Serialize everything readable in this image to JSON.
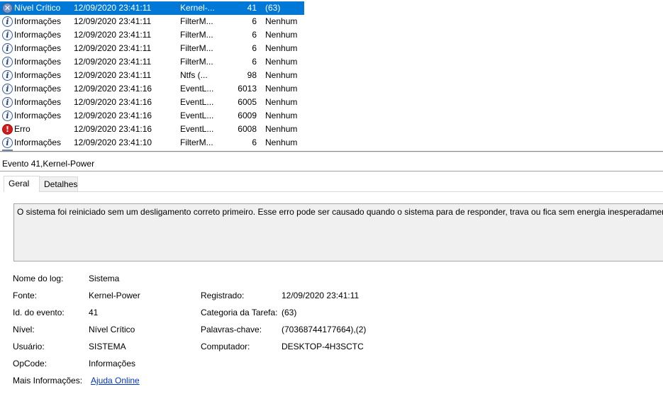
{
  "events": [
    {
      "level": "Nível Crítico",
      "icon": "critical-icon",
      "date": "12/09/2020 23:41:11",
      "source": "Kernel-...",
      "id": "41",
      "task": "(63)",
      "selected": true
    },
    {
      "level": "Informações",
      "icon": "info-icon",
      "date": "12/09/2020 23:41:11",
      "source": "FilterM...",
      "id": "6",
      "task": "Nenhum"
    },
    {
      "level": "Informações",
      "icon": "info-icon",
      "date": "12/09/2020 23:41:11",
      "source": "FilterM...",
      "id": "6",
      "task": "Nenhum"
    },
    {
      "level": "Informações",
      "icon": "info-icon",
      "date": "12/09/2020 23:41:11",
      "source": "FilterM...",
      "id": "6",
      "task": "Nenhum"
    },
    {
      "level": "Informações",
      "icon": "info-icon",
      "date": "12/09/2020 23:41:11",
      "source": "FilterM...",
      "id": "6",
      "task": "Nenhum"
    },
    {
      "level": "Informações",
      "icon": "info-icon",
      "date": "12/09/2020 23:41:11",
      "source": "Ntfs (...",
      "id": "98",
      "task": "Nenhum"
    },
    {
      "level": "Informações",
      "icon": "info-icon",
      "date": "12/09/2020 23:41:16",
      "source": "EventL...",
      "id": "6013",
      "task": "Nenhum"
    },
    {
      "level": "Informações",
      "icon": "info-icon",
      "date": "12/09/2020 23:41:16",
      "source": "EventL...",
      "id": "6005",
      "task": "Nenhum"
    },
    {
      "level": "Informações",
      "icon": "info-icon",
      "date": "12/09/2020 23:41:16",
      "source": "EventL...",
      "id": "6009",
      "task": "Nenhum"
    },
    {
      "level": "Erro",
      "icon": "error-icon",
      "date": "12/09/2020 23:41:16",
      "source": "EventL...",
      "id": "6008",
      "task": "Nenhum"
    },
    {
      "level": "Informações",
      "icon": "info-icon",
      "date": "12/09/2020 23:41:10",
      "source": "FilterM...",
      "id": "6",
      "task": "Nenhum"
    }
  ],
  "event_title": "Evento 41,Kernel-Power",
  "tabs": {
    "general": "Geral",
    "details": "Detalhes"
  },
  "description": "O sistema foi reiniciado sem um desligamento correto primeiro. Esse erro pode ser causado quando o sistema para de responder, trava ou fica sem energia inesperadamente.",
  "props": {
    "log_name_label": "Nome do log:",
    "log_name": "Sistema",
    "source_label": "Fonte:",
    "source": "Kernel-Power",
    "logged_label": "Registrado:",
    "logged": "12/09/2020 23:41:11",
    "event_id_label": "Id. do evento:",
    "event_id": "41",
    "task_label": "Categoria da Tarefa:",
    "task": "(63)",
    "level_label": "Nível:",
    "level": "Nível Crítico",
    "keywords_label": "Palavras-chave:",
    "keywords": "(70368744177664),(2)",
    "user_label": "Usuário:",
    "user": "SISTEMA",
    "computer_label": "Computador:",
    "computer": "DESKTOP-4H3SCTC",
    "opcode_label": "OpCode:",
    "opcode": "Informações",
    "more_info_label": "Mais Informações:",
    "more_info_link": "Ajuda Online"
  }
}
